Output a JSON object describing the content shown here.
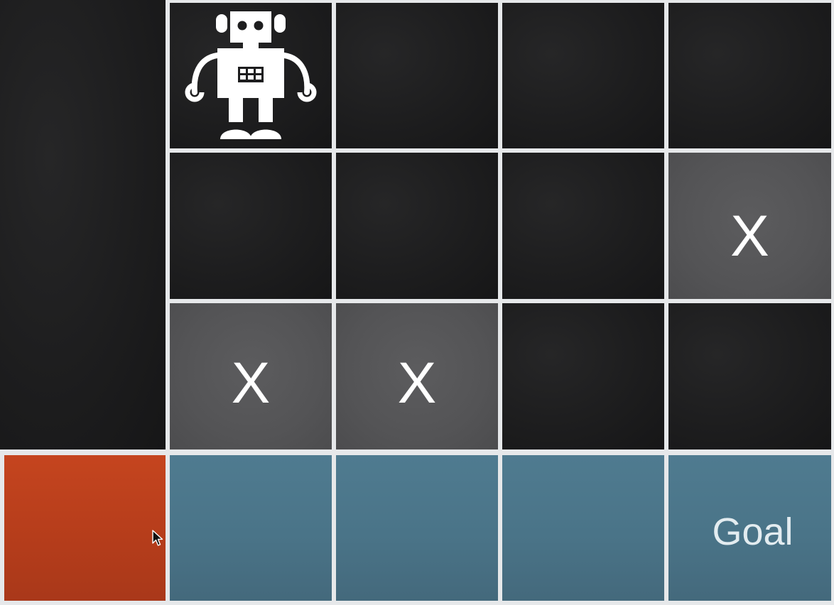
{
  "board": {
    "blocked_mark": "X",
    "goal_label": "Goal",
    "agent_icon": "robot-icon",
    "cursor_icon": "mouse-pointer-icon",
    "colors": {
      "empty": "#1e1e1f",
      "blocked": "#555557",
      "water": "#4a7488",
      "cliff": "#b63d1b",
      "grid": "#e6e8ea"
    }
  }
}
